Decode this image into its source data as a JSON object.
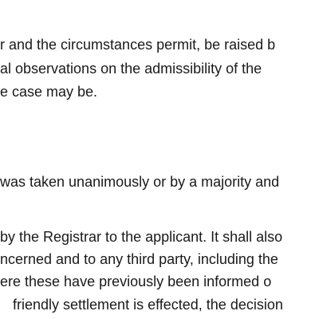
{
  "document": {
    "lines": [
      "r and the circumstances permit, be raised b",
      "al  observations  on  the  admissibility  of  the",
      "e case may be.",
      "was taken unanimously or by a majority and",
      "by the Registrar to the applicant. It shall also",
      "ncerned and to any third party, including the",
      "ere these have previously been informed o",
      "friendly settlement is effected, the decision"
    ]
  }
}
